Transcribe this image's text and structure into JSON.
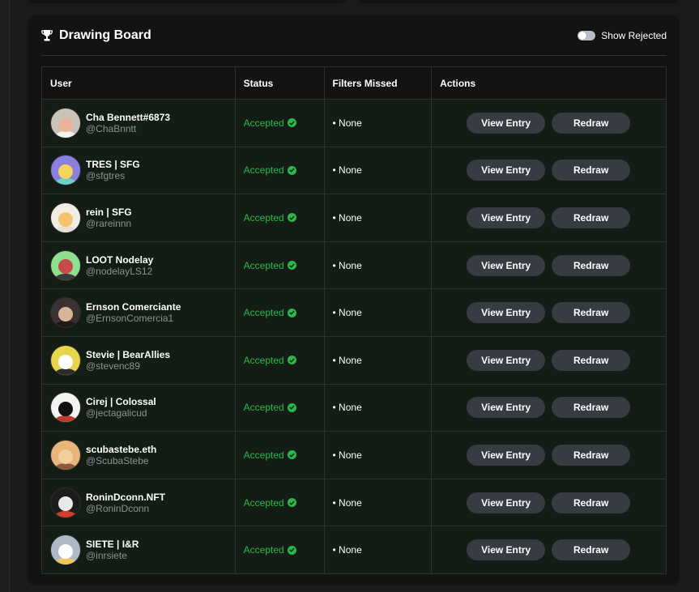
{
  "panel": {
    "title": "Drawing Board",
    "title_icon": "trophy-icon",
    "show_rejected_label": "Show Rejected",
    "show_rejected_on": false
  },
  "table": {
    "headers": {
      "user": "User",
      "status": "Status",
      "filters": "Filters Missed",
      "actions": "Actions"
    },
    "rows": [
      {
        "name": "Cha Bennett#6873",
        "handle": "@ChaBnntt",
        "status": "Accepted",
        "filters": "• None",
        "view": "View Entry",
        "redraw": "Redraw",
        "avatar_bg": "#c9c2b6",
        "avatar_face": "#e7b49a",
        "avatar_body": "#f2f2f2"
      },
      {
        "name": "TRES | SFG",
        "handle": "@sfgtres",
        "status": "Accepted",
        "filters": "• None",
        "view": "View Entry",
        "redraw": "Redraw",
        "avatar_bg": "#8b7fe0",
        "avatar_face": "#f4d35e",
        "avatar_body": "#6ad3c5"
      },
      {
        "name": "rein | SFG",
        "handle": "@rareinnn",
        "status": "Accepted",
        "filters": "• None",
        "view": "View Entry",
        "redraw": "Redraw",
        "avatar_bg": "#f1ede4",
        "avatar_face": "#f6c36b",
        "avatar_body": "#e6e0d2"
      },
      {
        "name": "LOOT Nodelay",
        "handle": "@nodelayLS12",
        "status": "Accepted",
        "filters": "• None",
        "view": "View Entry",
        "redraw": "Redraw",
        "avatar_bg": "#8fe08e",
        "avatar_face": "#c84a4a",
        "avatar_body": "#3a3a3a"
      },
      {
        "name": "Ernson Comerciante",
        "handle": "@ErnsonComercia1",
        "status": "Accepted",
        "filters": "• None",
        "view": "View Entry",
        "redraw": "Redraw",
        "avatar_bg": "#3a3230",
        "avatar_face": "#d8b49a",
        "avatar_body": "#1f1a19"
      },
      {
        "name": "Stevie | BearAllies",
        "handle": "@stevenc89",
        "status": "Accepted",
        "filters": "• None",
        "view": "View Entry",
        "redraw": "Redraw",
        "avatar_bg": "#e7d64a",
        "avatar_face": "#ffffff",
        "avatar_body": "#2c2c2c"
      },
      {
        "name": "Cirej | Colossal",
        "handle": "@jectagalicud",
        "status": "Accepted",
        "filters": "• None",
        "view": "View Entry",
        "redraw": "Redraw",
        "avatar_bg": "#f3f3f3",
        "avatar_face": "#111111",
        "avatar_body": "#c0392b"
      },
      {
        "name": "scubastebe.eth",
        "handle": "@ScubaStebe",
        "status": "Accepted",
        "filters": "• None",
        "view": "View Entry",
        "redraw": "Redraw",
        "avatar_bg": "#e8b67a",
        "avatar_face": "#f0cf9c",
        "avatar_body": "#8a5a3a"
      },
      {
        "name": "RoninDconn.NFT",
        "handle": "@RoninDconn",
        "status": "Accepted",
        "filters": "• None",
        "view": "View Entry",
        "redraw": "Redraw",
        "avatar_bg": "#1c1c1c",
        "avatar_face": "#e9e9e9",
        "avatar_body": "#d0402c"
      },
      {
        "name": "SIETE | I&R",
        "handle": "@inrsiete",
        "status": "Accepted",
        "filters": "• None",
        "view": "View Entry",
        "redraw": "Redraw",
        "avatar_bg": "#aeb9c8",
        "avatar_face": "#ffffff",
        "avatar_body": "#f1c75b"
      }
    ]
  }
}
